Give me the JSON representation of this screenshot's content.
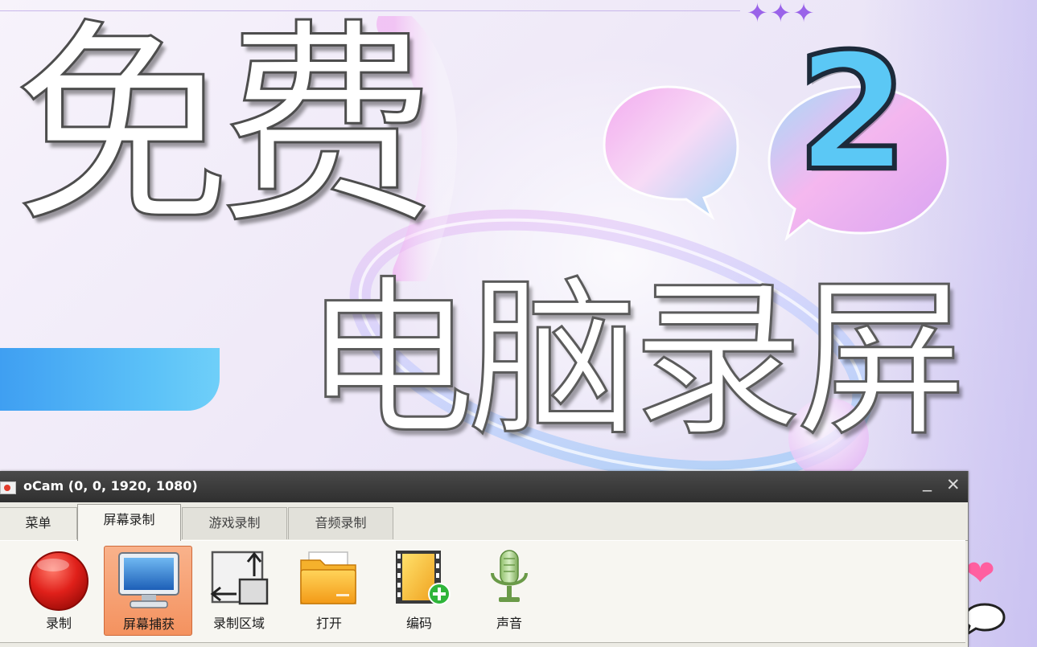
{
  "banner": {
    "title_line1": "免费",
    "title_line2": "电脑录屏",
    "episode_number": "2",
    "sparkles": "✦✦✦",
    "colors": {
      "accent_blue": "#5cc2f8",
      "number_blue": "#5bc8f5",
      "heart_pink": "#ff5fa0",
      "sparkle_purple": "#9a63e9"
    }
  },
  "window": {
    "title": "oCam (0, 0, 1920, 1080)",
    "minimize_glyph": "_",
    "close_glyph": "✕"
  },
  "tabs": [
    {
      "label": "菜单"
    },
    {
      "label": "屏幕录制",
      "active": true
    },
    {
      "label": "游戏录制"
    },
    {
      "label": "音频录制"
    }
  ],
  "toolbar": {
    "record_label": "录制",
    "capture_label": "屏幕捕获",
    "region_label": "录制区域",
    "open_label": "打开",
    "codec_label": "编码",
    "sound_label": "声音",
    "selected": "屏幕捕获",
    "colors": {
      "selected_bg": "#f4925f",
      "record_red": "#e0201a"
    }
  },
  "icons": {
    "record": "record-icon",
    "capture": "monitor-icon",
    "region": "record-region-icon",
    "open": "folder-icon",
    "codec": "film-add-icon",
    "sound": "microphone-icon",
    "heart": "heart-icon",
    "chat": "chat-bubble-icon"
  }
}
